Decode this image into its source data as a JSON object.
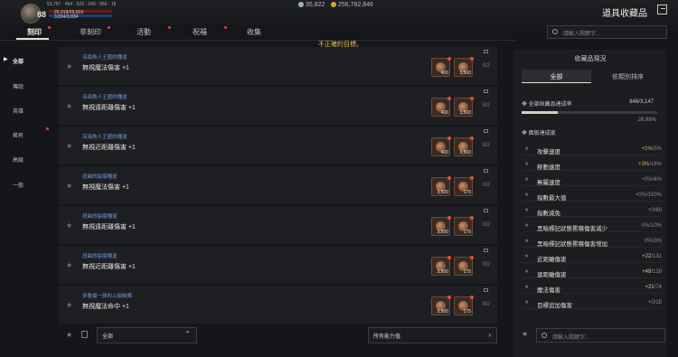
{
  "character": {
    "level": "88",
    "stats_line": "53,767 · 464 · 523 · 240 · 550 · 18",
    "hp": "25,019/25,019",
    "mp": "3,834/3,834"
  },
  "currency": [
    {
      "icon": "diamond-icon",
      "value": "35,822"
    },
    {
      "icon": "gold-coin-icon",
      "value": "256,782,846"
    }
  ],
  "header": {
    "title": "道具收藏品"
  },
  "tabs": [
    {
      "label": "刻印",
      "active": true
    },
    {
      "label": "非刻印",
      "active": false
    },
    {
      "label": "活動",
      "active": false
    },
    {
      "label": "祝福",
      "active": false
    },
    {
      "label": "收集",
      "active": false
    }
  ],
  "warning": "不正確的目標。",
  "search": {
    "placeholder": "請輸入關鍵字..."
  },
  "sidebar": {
    "items": [
      {
        "label": "全部",
        "active": true
      },
      {
        "label": "傳說",
        "active": false
      },
      {
        "label": "英雄",
        "active": false
      },
      {
        "label": "稀有",
        "active": false
      },
      {
        "label": "高級",
        "active": false
      },
      {
        "label": "一般",
        "active": false
      }
    ]
  },
  "rows": [
    {
      "source": "深海魚人王國的種違",
      "effect": "無視魔法傷害 +1",
      "items": [
        "400",
        "3,500"
      ],
      "count": "0/2"
    },
    {
      "source": "深海魚人王國的種違",
      "effect": "無視遠距離傷害 +1",
      "items": [
        "400",
        "3,500"
      ],
      "count": "0/2"
    },
    {
      "source": "深海魚人王國的種違",
      "effect": "無視近距離傷害 +1",
      "items": [
        "400",
        "3,500"
      ],
      "count": "0/2"
    },
    {
      "source": "扭曲的裂痕種違",
      "effect": "無視魔法傷害 +1",
      "items": [
        "3,500",
        "175"
      ],
      "count": "0/2"
    },
    {
      "source": "扭曲的裂痕種違",
      "effect": "無視遠距離傷害 +1",
      "items": [
        "3,500",
        "175"
      ],
      "count": "0/2"
    },
    {
      "source": "扭曲的裂痕種違",
      "effect": "無視近距離傷害 +1",
      "items": [
        "3,500",
        "175"
      ],
      "count": "0/2"
    },
    {
      "source": "多魯最一族的上級裝備",
      "effect": "無視魔法命中 +1",
      "items": [
        "3,500",
        "175"
      ],
      "count": "0/2"
    }
  ],
  "filters": {
    "category": "全部",
    "ability": "所有能力值"
  },
  "panel": {
    "title": "收藏品現況",
    "tabs": [
      "全部",
      "依類別排序"
    ],
    "total_label": "全部收藏品達成率",
    "total_value": "846/3,147",
    "progress": 0.2688,
    "percent": "26.88%",
    "section": "面板達成度",
    "stats": [
      {
        "name": "攻擊速度",
        "cur": "+1%",
        "max": "/5%",
        "gain": "gain"
      },
      {
        "name": "移動速度",
        "cur": "+3%",
        "max": "/16%",
        "gain": "gain"
      },
      {
        "name": "無屬速度",
        "cur": "+0%",
        "max": "/4%",
        "gain": ""
      },
      {
        "name": "指數最大值",
        "cur": "+0%",
        "max": "/150%",
        "gain": ""
      },
      {
        "name": "指數減免",
        "cur": "+0",
        "max": "/60",
        "gain": ""
      },
      {
        "name": "黑暗標記狀態累積傷害減少",
        "cur": "0%",
        "max": "/10%",
        "gain": ""
      },
      {
        "name": "黑暗標記狀態累積傷害增加",
        "cur": "0%",
        "max": "/3%",
        "gain": ""
      },
      {
        "name": "近距離傷害",
        "cur": "+22",
        "max": "/131",
        "gain": "gain2"
      },
      {
        "name": "遠距離傷害",
        "cur": "+49",
        "max": "/128",
        "gain": "gain2"
      },
      {
        "name": "魔法傷害",
        "cur": "+21",
        "max": "/74",
        "gain": "gain2"
      },
      {
        "name": "目標追加傷害",
        "cur": "+0",
        "max": "/15",
        "gain": ""
      }
    ]
  }
}
